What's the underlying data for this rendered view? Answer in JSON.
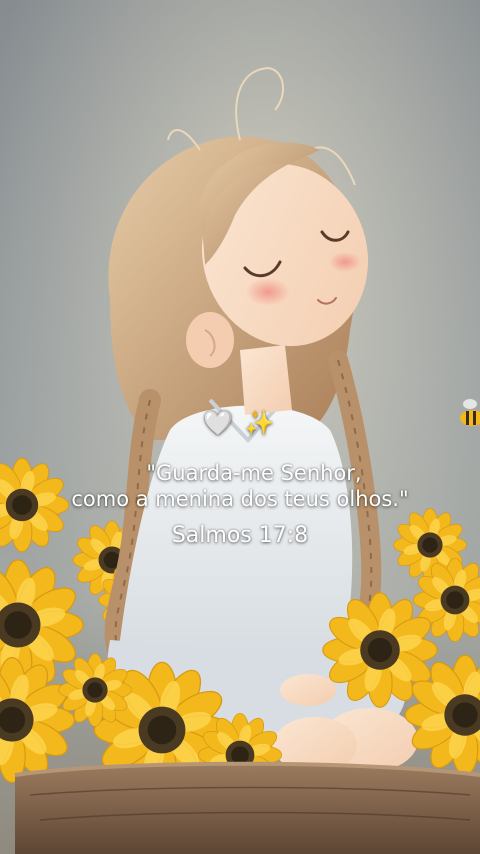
{
  "overlay": {
    "emojis": {
      "heart": "🤍",
      "sparkles": "✨"
    },
    "quote_line_1": "\"Guarda-me Senhor,",
    "quote_line_2": "como a menina dos teus olhos.\"",
    "reference": "Salmos 17:8"
  },
  "colors": {
    "background": "#8e9498",
    "sunflower_petal": "#f2b81c",
    "sunflower_center": "#4a3a22",
    "hair": "#c9a07a",
    "dress": "#e8ecef",
    "text": "#ffffff"
  }
}
